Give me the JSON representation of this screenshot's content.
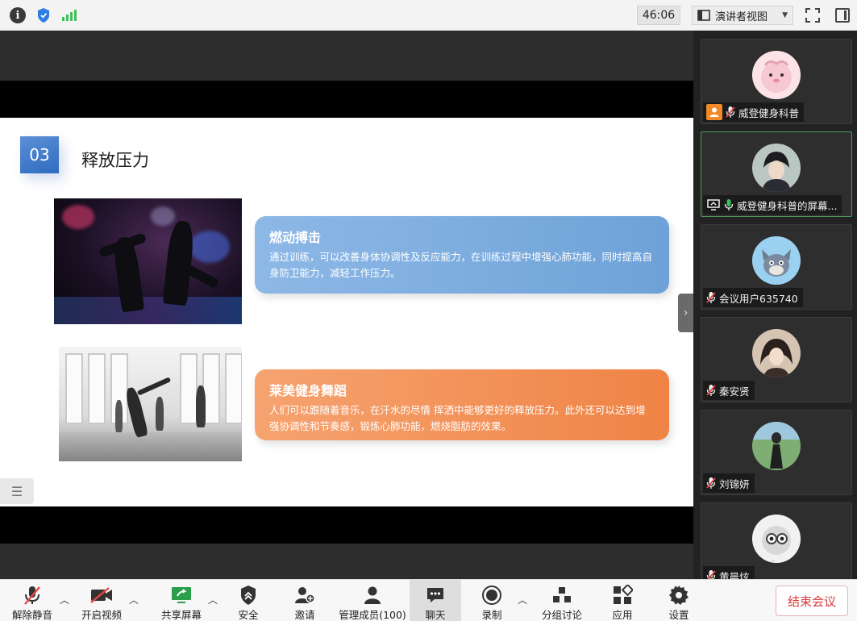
{
  "topbar": {
    "timer": "46:06",
    "view_mode": "演讲者视图",
    "icons": [
      "info-icon",
      "security-shield-icon",
      "signal-icon",
      "fullscreen-icon",
      "sidebar-toggle-icon"
    ]
  },
  "slide": {
    "section_number": "03",
    "title": "释放压力",
    "cards": [
      {
        "title": "燃动搏击",
        "text": "通过训练，可以改善身体协调性及反应能力，在训练过程中增强心肺功能，同时提高自身防卫能力，减轻工作压力。",
        "color": "#7aabdd"
      },
      {
        "title": "莱美健身舞蹈",
        "text": "人们可以跟随着音乐，在汗水的尽情 挥洒中能够更好的释放压力。此外还可以达到增强协调性和节奏感，锻炼心肺功能，燃烧脂肪的效果。",
        "color": "#f39257"
      }
    ]
  },
  "participants": [
    {
      "name": "威登健身科普",
      "role": "host",
      "mic": "muted"
    },
    {
      "name": "威登健身科普的屏幕...",
      "role": "sharing",
      "mic": "on"
    },
    {
      "name": "会议用户635740",
      "role": "",
      "mic": "muted"
    },
    {
      "name": "秦安贤",
      "role": "",
      "mic": "muted"
    },
    {
      "name": "刘锦妍",
      "role": "",
      "mic": "muted"
    },
    {
      "name": "黄晨炫",
      "role": "",
      "mic": "muted"
    }
  ],
  "toolbar": {
    "mute": "解除静音",
    "video": "开启视频",
    "share": "共享屏幕",
    "security": "安全",
    "invite": "邀请",
    "members": "管理成员(100)",
    "chat": "聊天",
    "record": "录制",
    "breakout": "分组讨论",
    "apps": "应用",
    "settings": "设置",
    "end": "结束会议"
  },
  "colors": {
    "accent_green": "#3fbf5a",
    "host_orange": "#f08a26",
    "end_red": "#d93b3b",
    "panel_bg": "#222222"
  }
}
